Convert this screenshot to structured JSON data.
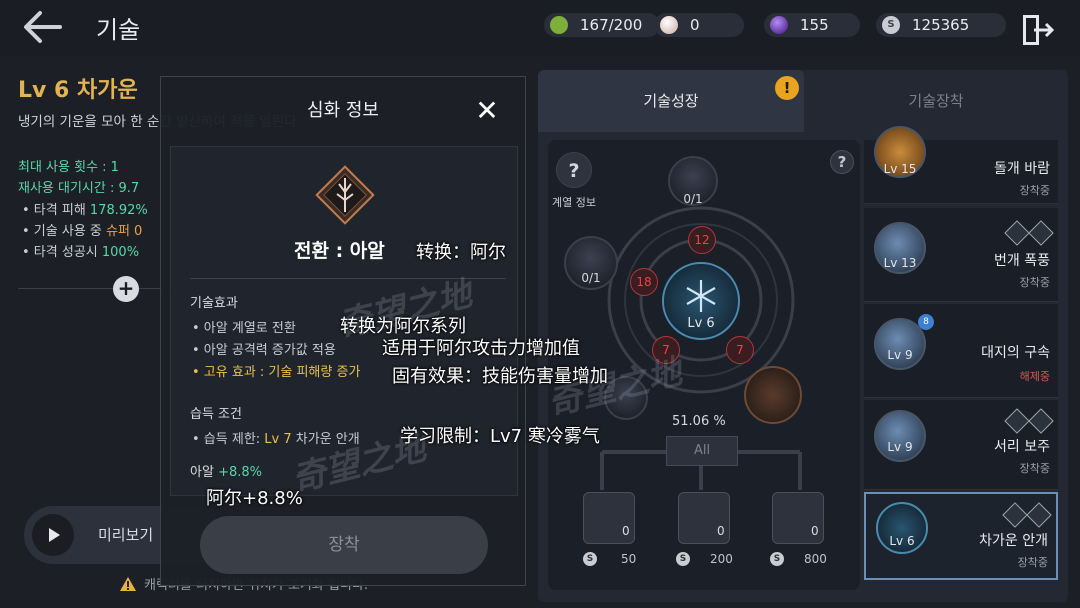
{
  "header": {
    "title": "기술",
    "resources": [
      {
        "icon": "stamina-icon",
        "value": "167/200",
        "color": "#8fbf4a"
      },
      {
        "icon": "pearl-icon",
        "value": "0",
        "color": "#e8d2cc"
      },
      {
        "icon": "purple-orb-icon",
        "value": "155",
        "color": "#7b3fd0"
      },
      {
        "icon": "silver-coin-icon",
        "value": "125365",
        "color": "#c9ccd3"
      }
    ]
  },
  "skill_panel": {
    "name": "Lv 6 차가운 ",
    "desc": "냉기의 기운을 모아 한 순간 발산하여 적을 얼린다.",
    "max_uses": "최대 사용 횟수 : 1",
    "cooldown": "재사용 대기시간 : 9.7",
    "b1_prefix": "• 타격 피해 ",
    "b1_value": "178.92%",
    "b2_prefix": "• 기술 사용 중 ",
    "b2_value": "슈퍼 0",
    "b3_prefix": "• 타격 성공시 ",
    "b3_value": "100%",
    "preview_label": "미리보기",
    "warning": "캐릭터를 터치하면 위치가 초기화 됩니다."
  },
  "tabs": {
    "growth": "기술성장",
    "equip": "기술장착",
    "alert": "!"
  },
  "tree": {
    "help": "?",
    "series_label": "계열 정보",
    "top_node": "0/1",
    "left_node": "0/1",
    "center_level": "Lv 6",
    "cost_top": "12",
    "cost_left": "18",
    "cost_bl": "7",
    "cost_br": "7",
    "percent": "51.06 %",
    "all_button": "All",
    "books": [
      {
        "count": "0",
        "cost": "50"
      },
      {
        "count": "0",
        "cost": "200"
      },
      {
        "count": "0",
        "cost": "800"
      }
    ],
    "coin_symbol": "S"
  },
  "skills": [
    {
      "level": "Lv 15",
      "name": "돌개 바람",
      "status": "장착중"
    },
    {
      "level": "Lv 13",
      "name": "번개 폭풍",
      "status": "장착중"
    },
    {
      "level": "Lv 9",
      "name": "대지의 구속",
      "status": "해제중",
      "badge": "8"
    },
    {
      "level": "Lv 9",
      "name": "서리 보주",
      "status": "장착중"
    },
    {
      "level": "Lv 6",
      "name": "차가운 안개",
      "status": "장착중"
    }
  ],
  "modal": {
    "title": "심화 정보",
    "close": "✕",
    "transform_title": "전환 : 아알",
    "effect_heading": "기술효과",
    "effect1": "• 아알 계열로 전환",
    "effect2": "• 아알 공격력 증가값 적용",
    "effect3": "• 고유 효과 : 기술 피해량 증가",
    "acquire_heading": "습득 조건",
    "acquire_prefix": "• 습득 제한: ",
    "acquire_value": "Lv 7",
    "acquire_suffix": " 차가운 안개",
    "bonus_label": "아알 ",
    "bonus_value": "+8.8%",
    "equip_button": "장착"
  },
  "overlay": {
    "t1": "转换：阿尔",
    "t2": "转换为阿尔系列",
    "t3": "适用于阿尔攻击力增加值",
    "t4": "固有效果：技能伤害量增加",
    "t5": "学习限制：Lv7 寒冷雾气",
    "t6": "阿尔+8.8%"
  },
  "watermark": "奇望之地"
}
